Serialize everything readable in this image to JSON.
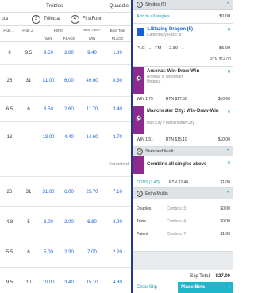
{
  "left": {
    "tabs": [
      "Trebles",
      "Quaddie"
    ],
    "combo_types": [
      {
        "label": "cta"
      },
      {
        "num": "3",
        "label": "Trifecta"
      },
      {
        "num": "4",
        "label": "FirstFour"
      }
    ],
    "headers": {
      "fluc1": "Fluc 1",
      "fluc2": "Fluc 2",
      "fixed": "Fixed",
      "best_tote_plus": "Best Tote+",
      "best_tote": "Best Tote",
      "win": "WIN",
      "place": "PLACE",
      "win2": "WIN",
      "place2": "PLACE"
    },
    "rows": [
      {
        "f1": "9",
        "f2": "9.5",
        "win": "9.50",
        "place": "2.80",
        "bt_win": "9.40",
        "bt_place": "1.80"
      },
      {
        "f1": "26",
        "f2": "31",
        "win": "31.00",
        "place": "6.00",
        "bt_win": "49.60",
        "bt_place": "8.30"
      },
      {
        "f1": "6.5",
        "f2": "6",
        "win": "6.50",
        "place": "2.60",
        "bt_win": "11.70",
        "bt_place": "3.40"
      },
      {
        "f1": "13",
        "f2": "",
        "win": "13.00",
        "place": "4.40",
        "bt_win": "14.60",
        "bt_place": "3.70"
      },
      {
        "scratched": "Scratched"
      },
      {
        "f1": "26",
        "f2": "31",
        "win": "31.00",
        "place": "6.00",
        "bt_win": "25.70",
        "bt_place": "7.10"
      },
      {
        "f1": "4.8",
        "f2": "5",
        "win": "6.00",
        "place": "2.00",
        "bt_win": "6.80",
        "bt_place": "2.20"
      },
      {
        "f1": "5.5",
        "f2": "6",
        "win": "5.00",
        "place": "2.30",
        "bt_win": "7.00",
        "bt_place": "2.20"
      },
      {
        "f1": "9.5",
        "f2": "10",
        "win": "10.00",
        "place": "3.40",
        "bt_win": "15.10",
        "bt_place": "4.80"
      }
    ]
  },
  "slip": {
    "singles": {
      "title": "Singles (5)",
      "add_all": "Add to all singles",
      "add_value": "$0.00"
    },
    "bet1": {
      "name": "1.Blazing Dragon (5)",
      "venue": "Canterbury Race: 8",
      "type": "PLC",
      "fixed_label": "FM",
      "odds": "2.80",
      "stake": "$5.00",
      "rtn": "RTN $14.00"
    },
    "bet2": {
      "name": "Arsenal: Win-Draw-Win",
      "sub1": "Arsenal V Tottenham",
      "sub2": "Hotspur",
      "odds": "WIN 1.75",
      "rtn": "RTN $17.50",
      "stake": "$10.00"
    },
    "bet3": {
      "name": "Manchester City: Win-Draw-Win",
      "sub1": "Hull City v Manchester City",
      "odds": "WIN 1.51",
      "rtn": "RTN $15.10",
      "stake": "$10.00"
    },
    "multi": {
      "title": "Standard Multi",
      "combine": "Combine all singles above",
      "odds": "ODDS (7.40)",
      "rtn": "RTN $7.40",
      "stake": "$1.00"
    },
    "extra": {
      "title": "Extra Multis",
      "rows": [
        {
          "name": "Doubles",
          "combos": "Combos: 3",
          "value": "$0.00"
        },
        {
          "name": "Trixie",
          "combos": "Combos: 4",
          "value": "$0.00"
        },
        {
          "name": "Patent",
          "combos": "Combos: 7",
          "value": "$1.00"
        }
      ]
    },
    "total_label": "Slip Total:",
    "total": "$27.00",
    "clear": "Clear Slip",
    "place": "Place Bets"
  },
  "colors": {
    "accent": "#18a0b5",
    "blue": "#1a5fd0",
    "place_btn": "#1fb6c9",
    "divider": "#1e3a8a"
  }
}
